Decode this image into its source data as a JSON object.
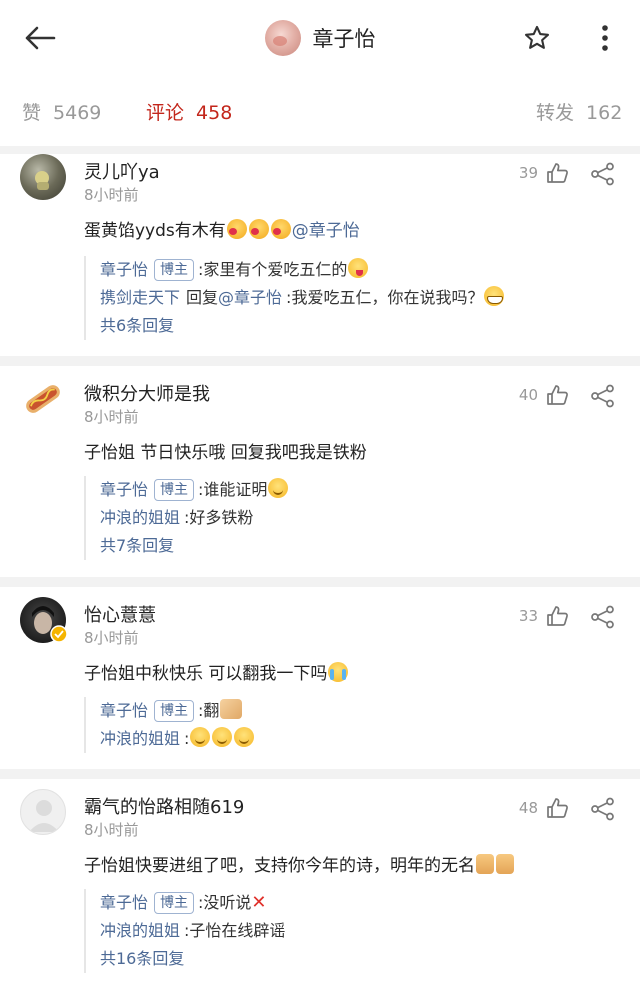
{
  "header": {
    "title": "章子怡"
  },
  "stats": {
    "likes_label": "赞",
    "likes_count": "5469",
    "comments_label": "评论",
    "comments_count": "458",
    "reposts_label": "转发",
    "reposts_count": "162"
  },
  "colors": {
    "accent": "#c3261b",
    "link": "#4d6a96",
    "muted": "#999999"
  },
  "comments": [
    {
      "user": "灵儿吖ya",
      "time": "8小时前",
      "likes": "39",
      "text": "蛋黄馅yyds有木有",
      "mention": "@章子怡",
      "replies": [
        {
          "name": "章子怡",
          "badge": "博主",
          "sep": ":",
          "content": "家里有个爱吃五仁的"
        },
        {
          "name": "携剑走天下",
          "reply_word": "回复",
          "reply_to": "@章子怡",
          "sep": ":",
          "content": "我爱吃五仁，你在说我吗？"
        }
      ],
      "more": "共6条回复"
    },
    {
      "user": "微积分大师是我",
      "time": "8小时前",
      "likes": "40",
      "text": "子怡姐 节日快乐哦 回复我吧我是铁粉",
      "replies": [
        {
          "name": "章子怡",
          "badge": "博主",
          "sep": ":",
          "content": "谁能证明"
        },
        {
          "name": "冲浪的姐姐",
          "sep": ":",
          "content": "好多铁粉"
        }
      ],
      "more": "共7条回复"
    },
    {
      "user": "怡心薏薏",
      "time": "8小时前",
      "likes": "33",
      "text": "子怡姐中秋快乐 可以翻我一下吗",
      "replies": [
        {
          "name": "章子怡",
          "badge": "博主",
          "sep": ":",
          "content": "翻"
        },
        {
          "name": "冲浪的姐姐",
          "sep": ":",
          "content": ""
        }
      ]
    },
    {
      "user": "霸气的怡路相随619",
      "time": "8小时前",
      "likes": "48",
      "text": "子怡姐快要进组了吧，支持你今年的诗，明年的无名",
      "replies": [
        {
          "name": "章子怡",
          "badge": "博主",
          "sep": ":",
          "content": "没听说"
        },
        {
          "name": "冲浪的姐姐",
          "sep": ":",
          "content": "子怡在线辟谣"
        }
      ],
      "more": "共16条回复"
    }
  ]
}
